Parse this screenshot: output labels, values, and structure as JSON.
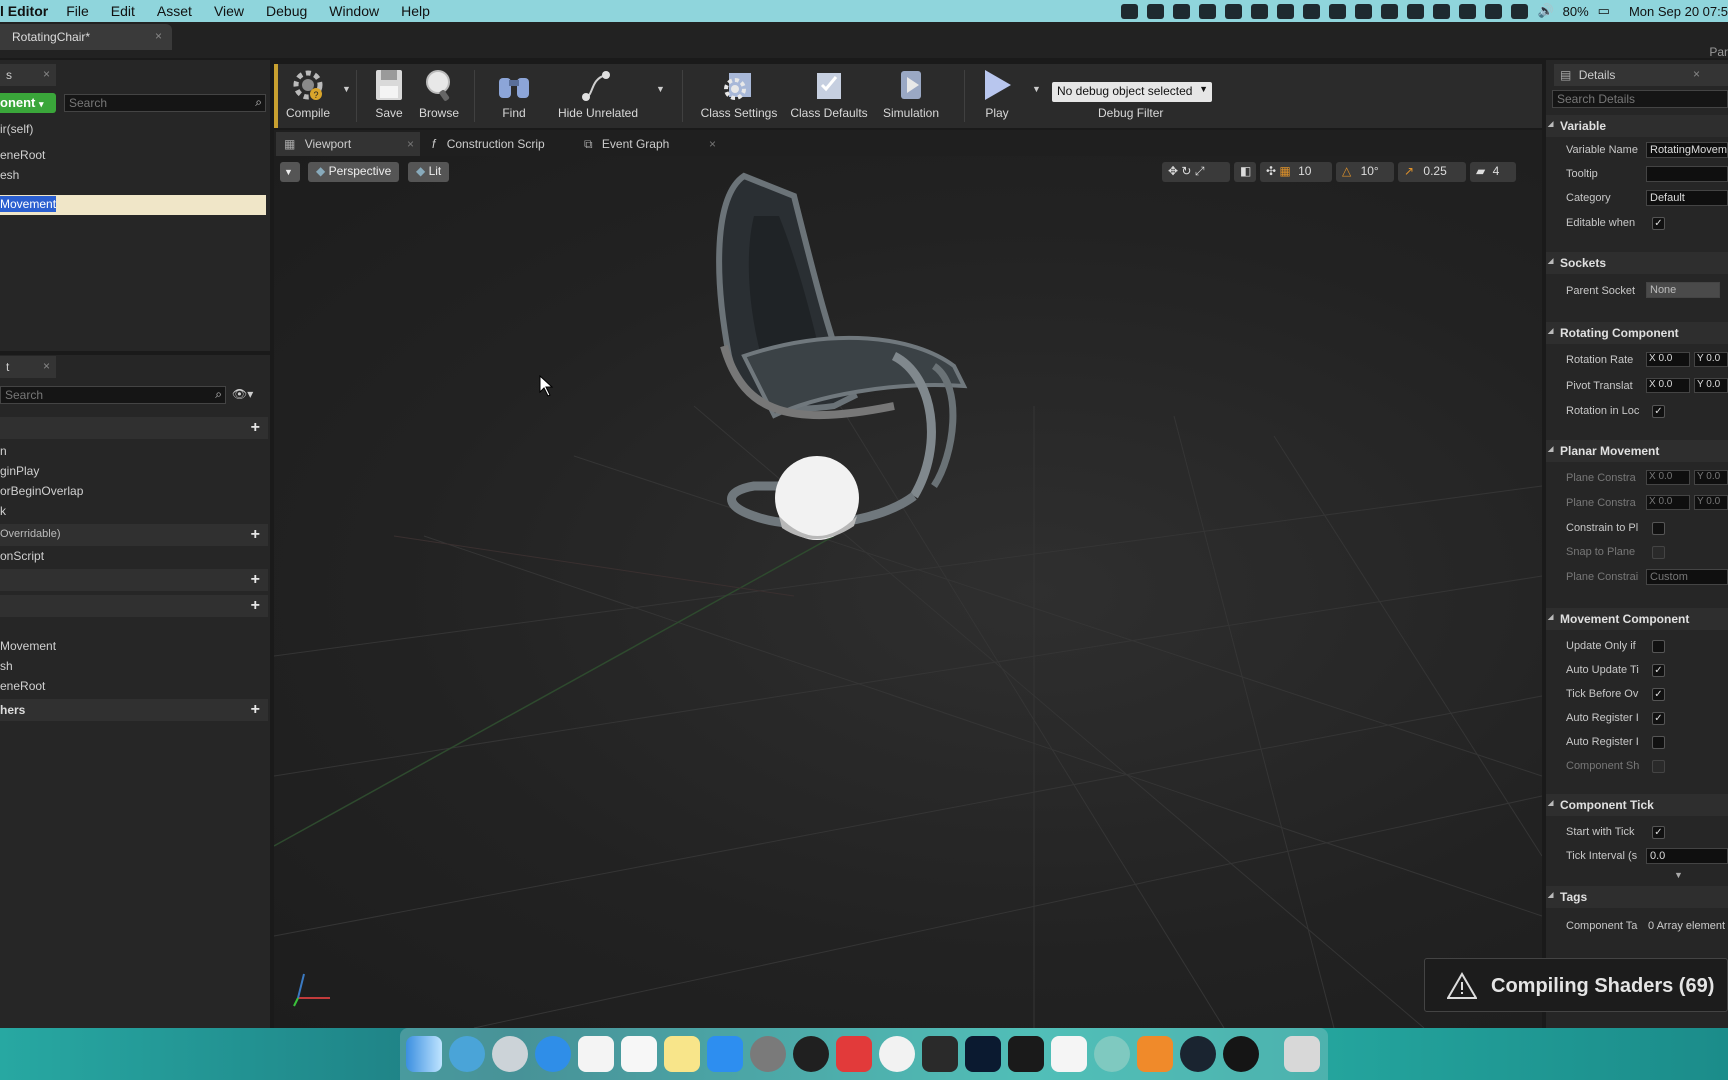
{
  "menubar": {
    "app": "l Editor",
    "items": [
      "File",
      "Edit",
      "Asset",
      "View",
      "Debug",
      "Window",
      "Help"
    ],
    "battery": "80%",
    "datetime": "Mon Sep 20  07:5"
  },
  "document_tab": {
    "title": "RotatingChair*",
    "close": "×"
  },
  "right_edge_tab": "Par",
  "components_panel": {
    "tab": "s",
    "add_button": "onent",
    "search_placeholder": "Search",
    "items": [
      "ir(self)",
      "eneRoot",
      "esh",
      "Movement"
    ]
  },
  "my_blueprint_panel": {
    "tab": "t",
    "search_placeholder": "Search",
    "graph_items": [
      "n",
      "ginPlay",
      "orBeginOverlap",
      "k"
    ],
    "overridable": "Overridable)",
    "construction": "onScript",
    "variable_items": [
      "Movement",
      "sh",
      "eneRoot"
    ],
    "dispatchers": "hers"
  },
  "toolbar": {
    "compile": "Compile",
    "save": "Save",
    "browse": "Browse",
    "find": "Find",
    "hide_unrelated": "Hide Unrelated",
    "class_settings": "Class Settings",
    "class_defaults": "Class Defaults",
    "simulation": "Simulation",
    "play": "Play",
    "debug_select": "No debug object selected",
    "debug_filter": "Debug Filter"
  },
  "editor_tabs": [
    "Viewport",
    "Construction Scrip",
    "Event Graph"
  ],
  "viewport": {
    "perspective": "Perspective",
    "lit": "Lit",
    "grid_snap": "10",
    "rot_snap": "10°",
    "scale_snap": "0.25",
    "cam_speed": "4"
  },
  "details": {
    "tab": "Details",
    "search_placeholder": "Search Details",
    "sections": {
      "variable": "Variable",
      "sockets": "Sockets",
      "rotating": "Rotating Component",
      "planar": "Planar Movement",
      "movement": "Movement Component",
      "tick": "Component Tick",
      "tags": "Tags"
    },
    "labels": {
      "variable_name": "Variable Name",
      "tooltip": "Tooltip",
      "category": "Category",
      "editable": "Editable when",
      "parent_socket": "Parent Socket",
      "rotation_rate": "Rotation Rate",
      "pivot": "Pivot Translat",
      "rot_local": "Rotation in Loc",
      "plane_c1": "Plane Constra",
      "plane_c2": "Plane Constra",
      "constrain": "Constrain to Pl",
      "snap": "Snap to Plane",
      "plane_c3": "Plane Constrai",
      "update_only": "Update Only if",
      "auto_update": "Auto Update Ti",
      "tick_before": "Tick Before Ov",
      "auto_reg1": "Auto Register I",
      "auto_reg2": "Auto Register I",
      "component_sh": "Component Sh",
      "start_tick": "Start with Tick",
      "tick_interval": "Tick Interval (s",
      "component_tags": "Component Ta"
    },
    "values": {
      "variable_name": "RotatingMovem",
      "category": "Default",
      "parent_socket": "None",
      "rotation_rate_x": "X 0.0",
      "rotation_rate_y": "Y 0.0",
      "pivot_x": "X 0.0",
      "pivot_y": "Y 0.0",
      "plane1_x": "X 0.0",
      "plane1_y": "Y 0.0",
      "plane2_x": "X 0.0",
      "plane2_y": "Y 0.0",
      "plane_custom": "Custom",
      "tick_interval": "0.0",
      "tags": "0 Array element"
    }
  },
  "toast": {
    "text": "Compiling Shaders (69)"
  }
}
